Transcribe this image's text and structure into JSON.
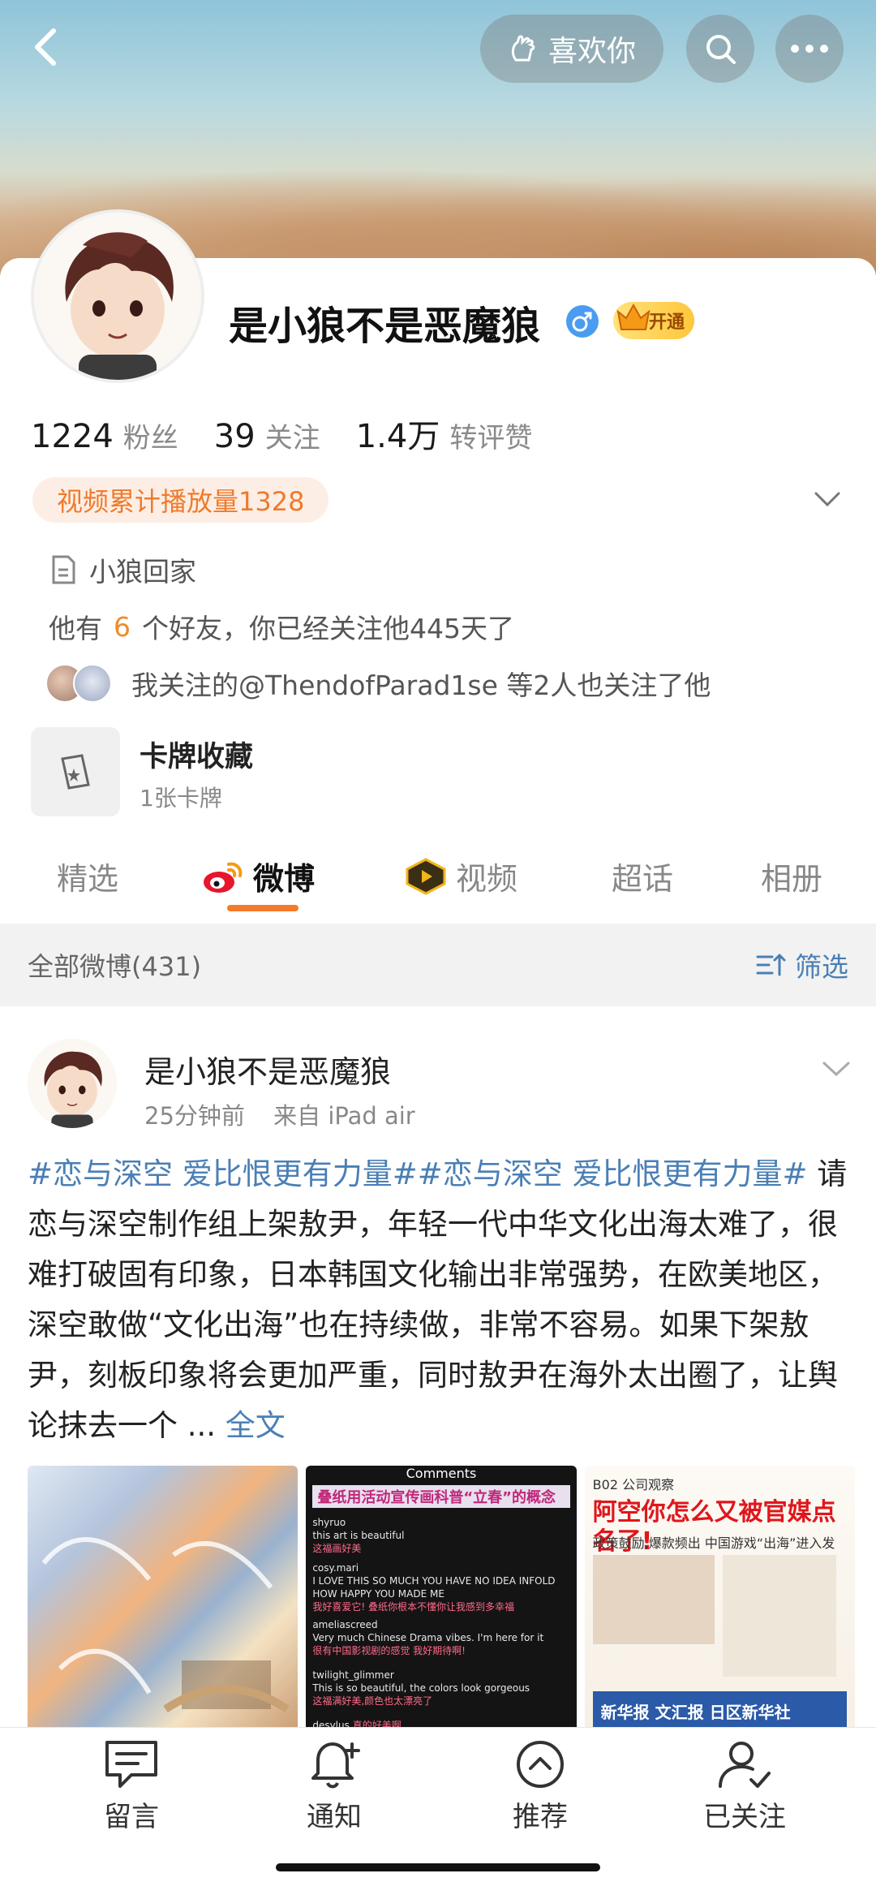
{
  "header": {
    "like_label": "喜欢你"
  },
  "profile": {
    "name": "是小狼不是恶魔狼",
    "vip_label": "开通",
    "stats": [
      {
        "num": "1224",
        "label": "粉丝"
      },
      {
        "num": "39",
        "label": "关注"
      },
      {
        "num": "1.4万",
        "label": "转评赞"
      }
    ],
    "video_plays": "视频累计播放量1328",
    "bio": "小狼回家",
    "friends_prefix": "他有",
    "friends_count": "6",
    "friends_suffix": "个好友，你已经关注他445天了",
    "mutual_text": "我关注的@ThendofParad1se 等2人也关注了他",
    "card_title": "卡牌收藏",
    "card_sub": "1张卡牌"
  },
  "tabs": [
    {
      "label": "精选",
      "active": false
    },
    {
      "label": "微博",
      "active": true
    },
    {
      "label": "视频",
      "active": false
    },
    {
      "label": "超话",
      "active": false
    },
    {
      "label": "相册",
      "active": false
    }
  ],
  "filter_bar": {
    "count_label": "全部微博(431)",
    "filter_label": "筛选"
  },
  "post": {
    "author": "是小狼不是恶魔狼",
    "time": "25分钟前",
    "source": "来自 iPad air",
    "tag1": "#恋与深空 爱比恨更有力量#",
    "tag2": "#恋与深空 爱比恨更有力量#",
    "body": " 请恋与深空制作组上架敖尹，年轻一代中华文化出海太难了，很难打破固有印象，日本韩国文化输出非常强势，在欧美地区，深空敢做“文化出海”也在持续做，非常不容易。如果下架敖尹，刻板印象将会更加严重，同时敖尹在海外太出圈了，让舆论抹去一个 ...",
    "more_label": " 全文",
    "images": {
      "comments": {
        "title": "Comments",
        "head": "叠纸用活动宣传画科普“立春”的概念",
        "rows": [
          {
            "user": "shyruo",
            "text": "this art is beautiful",
            "cn": "这福画好美"
          },
          {
            "user": "cosy.mari",
            "text": "I LOVE THIS SO MUCH YOU HAVE NO IDEA INFOLD HOW HAPPY YOU MADE ME",
            "cn": "我好喜爱它! 叠纸你根本不懂你让我感到多幸福"
          },
          {
            "user": "ameliascreed",
            "text": "Very much Chinese Drama vibes. I'm here for it",
            "cn": "很有中国影视剧的感觉 我好期待啊!"
          },
          {
            "user": "twilight_glimmer",
            "text": "This is so beautiful, the colors look gorgeous",
            "cn": "这福满好美,颜色也太漂亮了"
          },
          {
            "user": "desylus",
            "text": "",
            "cn": "真的好美啊"
          }
        ]
      },
      "paper": {
        "head": "B02 公司观察",
        "title": "阿空你怎么又被官媒点名了!",
        "sub": "政策鼓励,爆款频出 中国游戏“出海”进入发展新周期",
        "foot": "新华报 文汇报 日区新华社"
      }
    }
  },
  "bottom_nav": [
    {
      "label": "留言",
      "icon": "message-icon"
    },
    {
      "label": "通知",
      "icon": "bell-icon"
    },
    {
      "label": "推荐",
      "icon": "recommend-icon"
    },
    {
      "label": "已关注",
      "icon": "followed-icon"
    }
  ],
  "colors": {
    "accent": "#f47a2a",
    "link": "#4a7fb5"
  }
}
